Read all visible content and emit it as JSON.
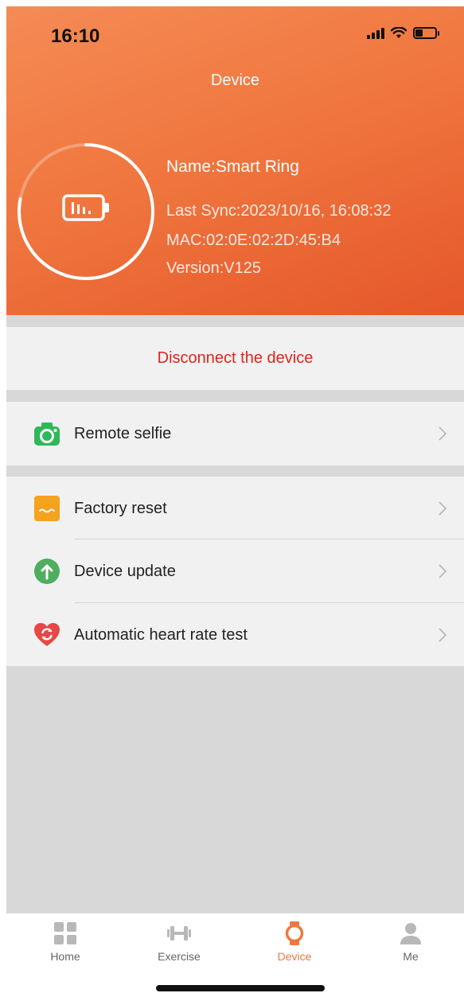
{
  "status_bar": {
    "time": "16:10"
  },
  "header": {
    "title": "Device",
    "ring_progress": 0.78,
    "device": {
      "name": "Name:Smart Ring",
      "last_sync": "Last Sync:2023/10/16, 16:08:32",
      "mac": "MAC:02:0E:02:2D:45:B4",
      "version": "Version:V125"
    }
  },
  "disconnect_label": "Disconnect the device",
  "menu": {
    "remote_selfie": "Remote selfie",
    "factory_reset": "Factory reset",
    "device_update": "Device update",
    "heart_rate_test": "Automatic heart rate test"
  },
  "tabs": [
    {
      "label": "Home",
      "icon": "grid-icon"
    },
    {
      "label": "Exercise",
      "icon": "dumbbell-icon"
    },
    {
      "label": "Device",
      "icon": "watch-icon",
      "active": true
    },
    {
      "label": "Me",
      "icon": "person-icon"
    }
  ],
  "colors": {
    "accent": "#f0773f",
    "header_dark": "#e5572a",
    "danger": "#e0241f",
    "selfie_green": "#2fb85a",
    "reset_orange": "#f5a21f",
    "update_green": "#4fae5f",
    "heart_red": "#e84747"
  }
}
